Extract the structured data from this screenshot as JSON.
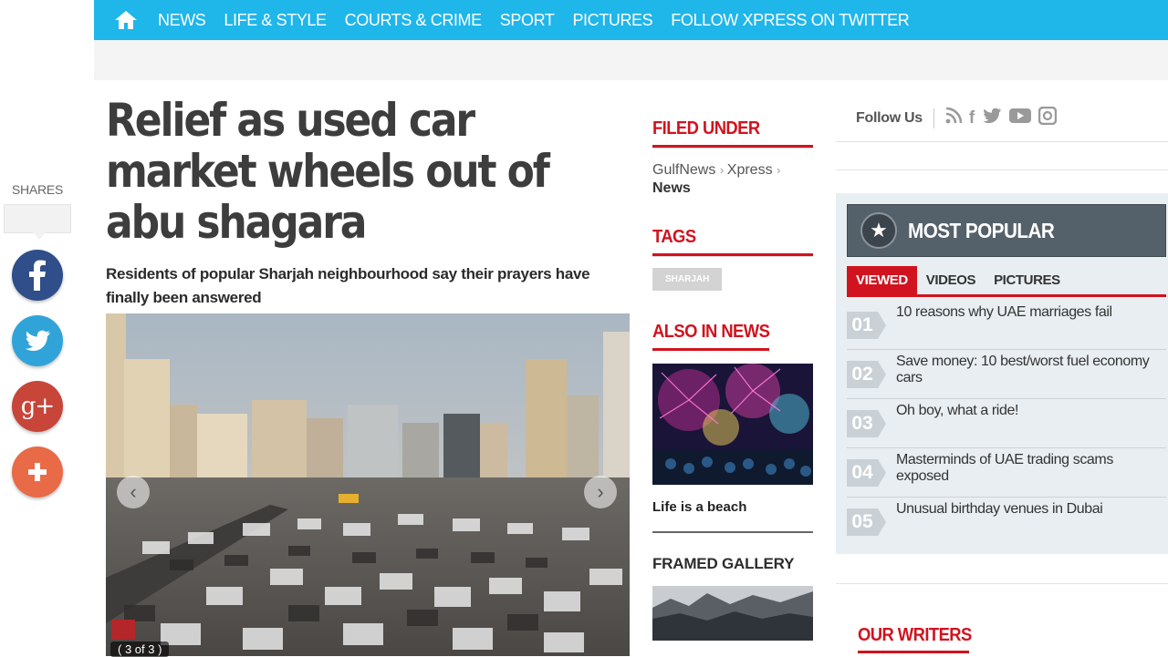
{
  "nav": {
    "items": [
      "NEWS",
      "LIFE & STYLE",
      "COURTS & CRIME",
      "SPORT",
      "PICTURES",
      "FOLLOW XPRESS ON TWITTER"
    ]
  },
  "shares": {
    "label": "SHARES"
  },
  "article": {
    "headline": "Relief as used car market wheels out of abu shagara",
    "subhead": "Residents of popular Sharjah neighbourhood say their prayers have finally been answered",
    "gallery_counter": "( 3 of 3 )"
  },
  "filed_under": {
    "title": "FILED UNDER",
    "crumb1": "GulfNews",
    "crumb2": "Xpress",
    "crumb3": "News"
  },
  "tags": {
    "title": "TAGS",
    "items": [
      "SHARJAH"
    ]
  },
  "also_in_news": {
    "title": "ALSO IN NEWS",
    "caption": "Life is a beach"
  },
  "framed_gallery": {
    "title": "FRAMED GALLERY"
  },
  "follow_us": {
    "label": "Follow Us"
  },
  "most_popular": {
    "title": "MOST POPULAR",
    "tabs": [
      "VIEWED",
      "VIDEOS",
      "PICTURES"
    ],
    "items": [
      {
        "num": "01",
        "title": "10 reasons why UAE marriages fail"
      },
      {
        "num": "02",
        "title": "Save money: 10 best/worst fuel economy cars"
      },
      {
        "num": "03",
        "title": "Oh boy, what a ride!"
      },
      {
        "num": "04",
        "title": "Masterminds of UAE trading scams exposed"
      },
      {
        "num": "05",
        "title": "Unusual birthday venues in Dubai"
      }
    ]
  },
  "our_writers": {
    "title": "OUR WRITERS"
  },
  "colors": {
    "nav": "#1fb6ea",
    "accent": "#d0131e",
    "popular_header": "#55616a"
  }
}
